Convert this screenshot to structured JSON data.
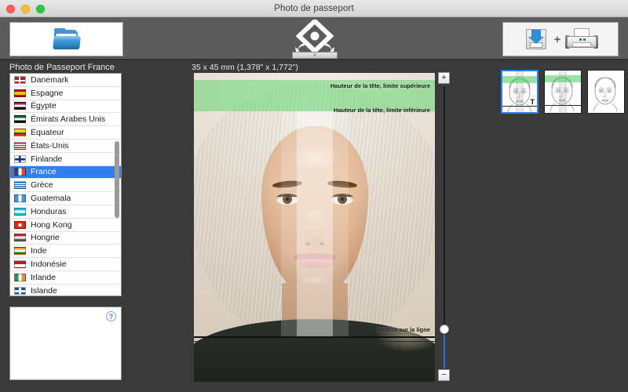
{
  "window": {
    "title": "Photo de passeport",
    "controls": {
      "close": "close",
      "minimize": "minimize",
      "zoom": "zoom"
    }
  },
  "toolbar": {
    "open_label": "Ouvrir",
    "open_icon": "folder-icon",
    "move_tool_icon": "move-rotate-tool-icon",
    "move_tool_dropdown": "v",
    "export_save_icon": "save-to-disk-icon",
    "export_plus": "+",
    "export_print_icon": "printer-icon"
  },
  "sidebar": {
    "panel_label": "Photo de Passeport France",
    "selected_country": "France",
    "countries": [
      {
        "name": "Danemark",
        "flag": "dk"
      },
      {
        "name": "Espagne",
        "flag": "es"
      },
      {
        "name": "Égypte",
        "flag": "eg"
      },
      {
        "name": "Émirats Arabes Unis",
        "flag": "ae"
      },
      {
        "name": "Équateur",
        "flag": "ec"
      },
      {
        "name": "États-Unis",
        "flag": "us"
      },
      {
        "name": "Finlande",
        "flag": "fi"
      },
      {
        "name": "France",
        "flag": "fr"
      },
      {
        "name": "Grèce",
        "flag": "gr"
      },
      {
        "name": "Guatemala",
        "flag": "gt"
      },
      {
        "name": "Honduras",
        "flag": "hn"
      },
      {
        "name": "Hong Kong",
        "flag": "hk"
      },
      {
        "name": "Hongrie",
        "flag": "hu"
      },
      {
        "name": "Inde",
        "flag": "in"
      },
      {
        "name": "Indonésie",
        "flag": "id"
      },
      {
        "name": "Irlande",
        "flag": "ie"
      },
      {
        "name": "Islande",
        "flag": "is"
      }
    ],
    "info_panel": {
      "text": "",
      "help_label": "?"
    }
  },
  "main": {
    "dimensions_label": "35 x 45 mm (1,378\" x 1,772\")",
    "guides": {
      "head_top": "Hauteur de la tête, limite supérieure",
      "head_bottom": "Hauteur de la tête, limite inférieure",
      "chin": "Menton sur la ligne"
    },
    "zoom": {
      "increase_label": "+",
      "decrease_label": "−",
      "value_percent": 82
    }
  },
  "templates": {
    "items": [
      {
        "id": "template-1",
        "selected": true,
        "badge": "T",
        "has_green_band": true,
        "has_chin_line": true,
        "has_center_band": true
      },
      {
        "id": "template-2",
        "selected": false,
        "badge": "",
        "has_green_band": true,
        "has_chin_line": true,
        "has_center_band": true
      },
      {
        "id": "template-3",
        "selected": false,
        "badge": "",
        "has_green_band": false,
        "has_chin_line": false,
        "has_center_band": false
      }
    ]
  },
  "colors": {
    "accent": "#2f7ef0",
    "toolbar_bg": "#5b5b5b",
    "workspace_bg": "#3a3a3a",
    "guide_green": "#46d25a",
    "titlebar_bg": "#e0e0e0"
  }
}
